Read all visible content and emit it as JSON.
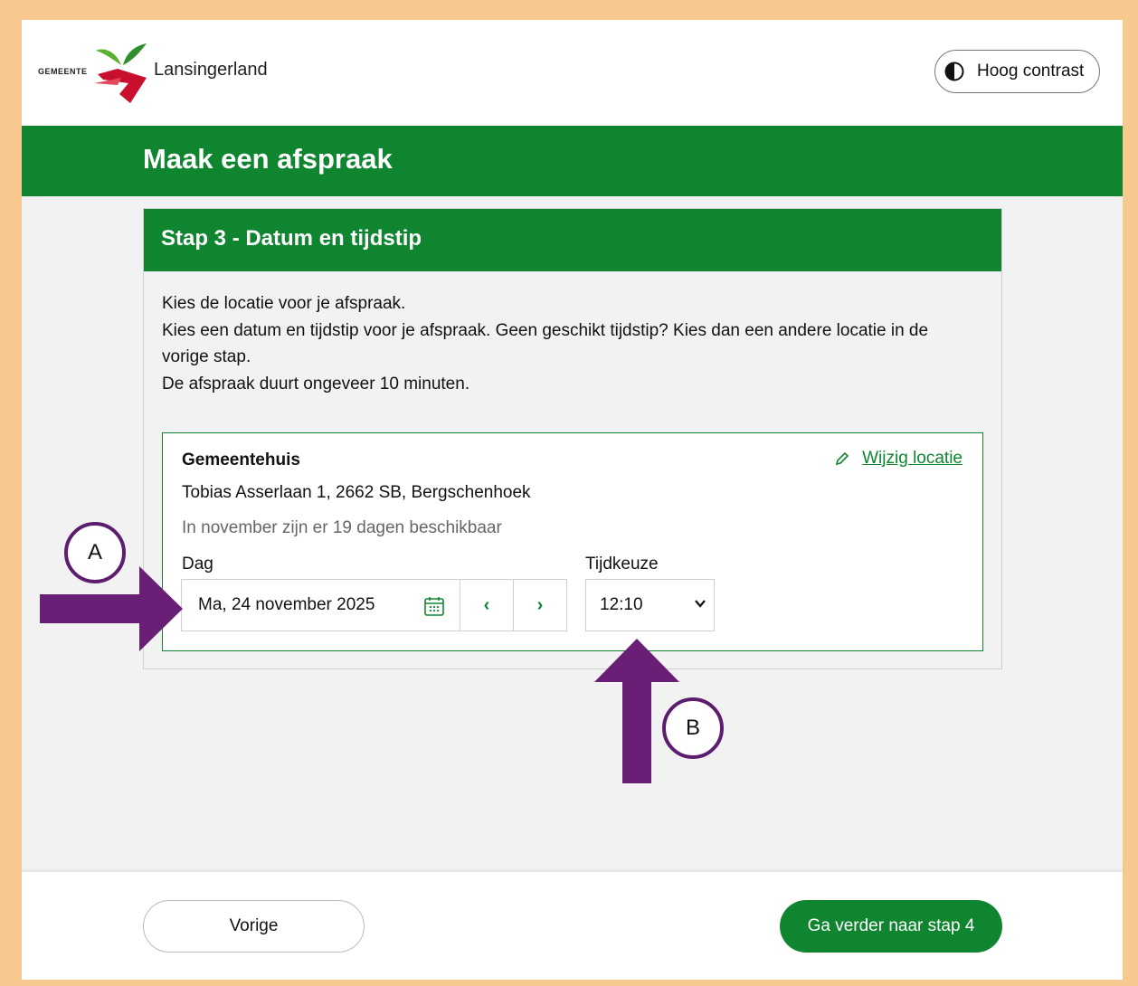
{
  "header": {
    "logo_prefix": "GEMEENTE",
    "logo_name": "Lansingerland",
    "contrast_label": "Hoog contrast"
  },
  "banner": {
    "title": "Maak een afspraak"
  },
  "step": {
    "title": "Stap 3 - Datum en tijdstip",
    "intro": [
      "Kies de locatie voor je afspraak.",
      "Kies een datum en tijdstip voor je afspraak. Geen geschikt tijdstip? Kies dan een andere locatie in de vorige stap.",
      "De afspraak duurt ongeveer 10 minuten."
    ]
  },
  "location": {
    "name": "Gemeentehuis",
    "address": "Tobias Asserlaan 1, 2662 SB, Bergschenhoek",
    "availability": "In november zijn er 19 dagen beschikbaar",
    "edit_label": "Wijzig locatie"
  },
  "picker": {
    "day_label": "Dag",
    "day_value": "Ma, 24 november 2025",
    "time_label": "Tijdkeuze",
    "time_value": "12:10",
    "prev_symbol": "‹",
    "next_symbol": "›"
  },
  "footer": {
    "prev_label": "Vorige",
    "next_label": "Ga verder naar stap 4"
  },
  "annotations": {
    "a": "A",
    "b": "B"
  },
  "colors": {
    "brand_green": "#0f8530",
    "annotation_purple": "#5c1d6e",
    "frame": "#f7c98e"
  }
}
